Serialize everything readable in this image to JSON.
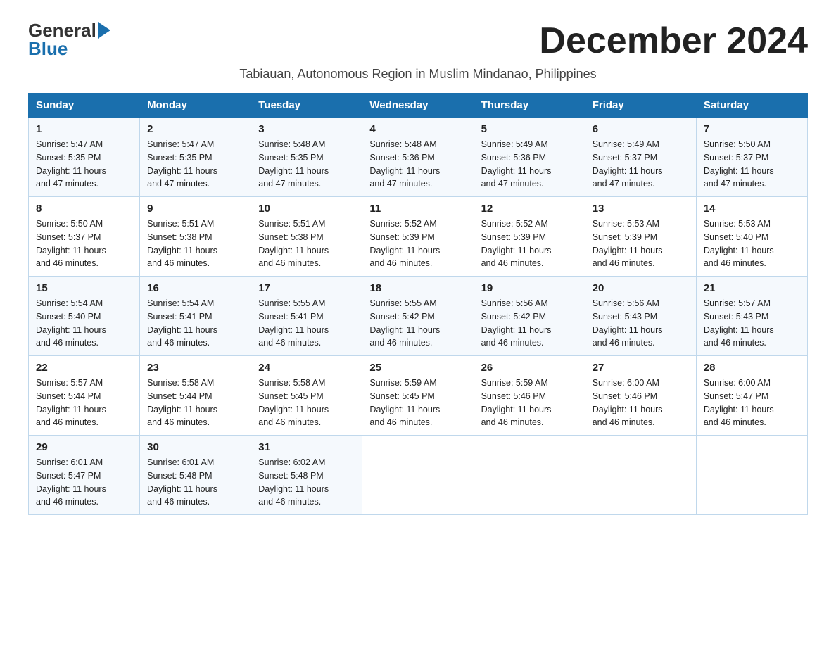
{
  "header": {
    "logo_general": "General",
    "logo_blue": "Blue",
    "month_title": "December 2024",
    "subtitle": "Tabiauan, Autonomous Region in Muslim Mindanao, Philippines"
  },
  "weekdays": [
    "Sunday",
    "Monday",
    "Tuesday",
    "Wednesday",
    "Thursday",
    "Friday",
    "Saturday"
  ],
  "weeks": [
    [
      {
        "date": "1",
        "sunrise": "5:47 AM",
        "sunset": "5:35 PM",
        "daylight": "11 hours and 47 minutes."
      },
      {
        "date": "2",
        "sunrise": "5:47 AM",
        "sunset": "5:35 PM",
        "daylight": "11 hours and 47 minutes."
      },
      {
        "date": "3",
        "sunrise": "5:48 AM",
        "sunset": "5:35 PM",
        "daylight": "11 hours and 47 minutes."
      },
      {
        "date": "4",
        "sunrise": "5:48 AM",
        "sunset": "5:36 PM",
        "daylight": "11 hours and 47 minutes."
      },
      {
        "date": "5",
        "sunrise": "5:49 AM",
        "sunset": "5:36 PM",
        "daylight": "11 hours and 47 minutes."
      },
      {
        "date": "6",
        "sunrise": "5:49 AM",
        "sunset": "5:37 PM",
        "daylight": "11 hours and 47 minutes."
      },
      {
        "date": "7",
        "sunrise": "5:50 AM",
        "sunset": "5:37 PM",
        "daylight": "11 hours and 47 minutes."
      }
    ],
    [
      {
        "date": "8",
        "sunrise": "5:50 AM",
        "sunset": "5:37 PM",
        "daylight": "11 hours and 46 minutes."
      },
      {
        "date": "9",
        "sunrise": "5:51 AM",
        "sunset": "5:38 PM",
        "daylight": "11 hours and 46 minutes."
      },
      {
        "date": "10",
        "sunrise": "5:51 AM",
        "sunset": "5:38 PM",
        "daylight": "11 hours and 46 minutes."
      },
      {
        "date": "11",
        "sunrise": "5:52 AM",
        "sunset": "5:39 PM",
        "daylight": "11 hours and 46 minutes."
      },
      {
        "date": "12",
        "sunrise": "5:52 AM",
        "sunset": "5:39 PM",
        "daylight": "11 hours and 46 minutes."
      },
      {
        "date": "13",
        "sunrise": "5:53 AM",
        "sunset": "5:39 PM",
        "daylight": "11 hours and 46 minutes."
      },
      {
        "date": "14",
        "sunrise": "5:53 AM",
        "sunset": "5:40 PM",
        "daylight": "11 hours and 46 minutes."
      }
    ],
    [
      {
        "date": "15",
        "sunrise": "5:54 AM",
        "sunset": "5:40 PM",
        "daylight": "11 hours and 46 minutes."
      },
      {
        "date": "16",
        "sunrise": "5:54 AM",
        "sunset": "5:41 PM",
        "daylight": "11 hours and 46 minutes."
      },
      {
        "date": "17",
        "sunrise": "5:55 AM",
        "sunset": "5:41 PM",
        "daylight": "11 hours and 46 minutes."
      },
      {
        "date": "18",
        "sunrise": "5:55 AM",
        "sunset": "5:42 PM",
        "daylight": "11 hours and 46 minutes."
      },
      {
        "date": "19",
        "sunrise": "5:56 AM",
        "sunset": "5:42 PM",
        "daylight": "11 hours and 46 minutes."
      },
      {
        "date": "20",
        "sunrise": "5:56 AM",
        "sunset": "5:43 PM",
        "daylight": "11 hours and 46 minutes."
      },
      {
        "date": "21",
        "sunrise": "5:57 AM",
        "sunset": "5:43 PM",
        "daylight": "11 hours and 46 minutes."
      }
    ],
    [
      {
        "date": "22",
        "sunrise": "5:57 AM",
        "sunset": "5:44 PM",
        "daylight": "11 hours and 46 minutes."
      },
      {
        "date": "23",
        "sunrise": "5:58 AM",
        "sunset": "5:44 PM",
        "daylight": "11 hours and 46 minutes."
      },
      {
        "date": "24",
        "sunrise": "5:58 AM",
        "sunset": "5:45 PM",
        "daylight": "11 hours and 46 minutes."
      },
      {
        "date": "25",
        "sunrise": "5:59 AM",
        "sunset": "5:45 PM",
        "daylight": "11 hours and 46 minutes."
      },
      {
        "date": "26",
        "sunrise": "5:59 AM",
        "sunset": "5:46 PM",
        "daylight": "11 hours and 46 minutes."
      },
      {
        "date": "27",
        "sunrise": "6:00 AM",
        "sunset": "5:46 PM",
        "daylight": "11 hours and 46 minutes."
      },
      {
        "date": "28",
        "sunrise": "6:00 AM",
        "sunset": "5:47 PM",
        "daylight": "11 hours and 46 minutes."
      }
    ],
    [
      {
        "date": "29",
        "sunrise": "6:01 AM",
        "sunset": "5:47 PM",
        "daylight": "11 hours and 46 minutes."
      },
      {
        "date": "30",
        "sunrise": "6:01 AM",
        "sunset": "5:48 PM",
        "daylight": "11 hours and 46 minutes."
      },
      {
        "date": "31",
        "sunrise": "6:02 AM",
        "sunset": "5:48 PM",
        "daylight": "11 hours and 46 minutes."
      },
      null,
      null,
      null,
      null
    ]
  ],
  "labels": {
    "sunrise": "Sunrise:",
    "sunset": "Sunset:",
    "daylight": "Daylight:"
  }
}
